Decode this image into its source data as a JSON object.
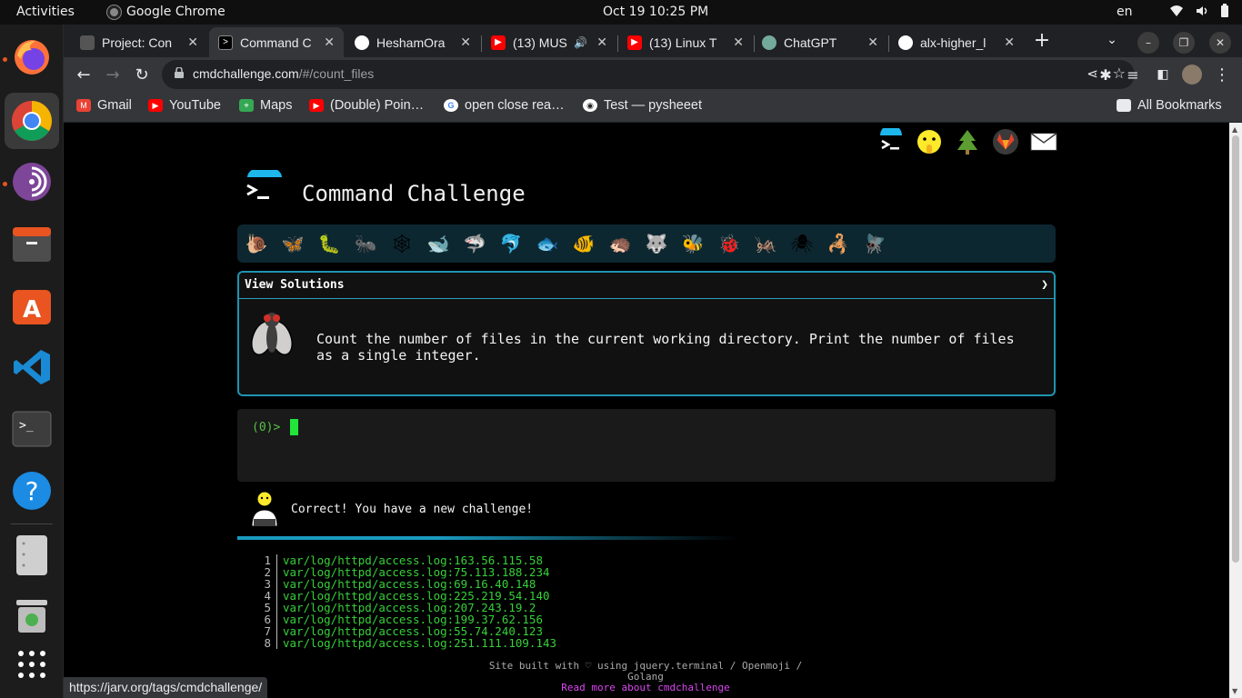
{
  "topbar": {
    "activities": "Activities",
    "app_name": "Google Chrome",
    "clock": "Oct 19  10:25 PM",
    "lang": "en"
  },
  "tabs": [
    {
      "title": "Project: Con",
      "icon": "project-icon"
    },
    {
      "title": "Command C",
      "icon": "terminal-icon"
    },
    {
      "title": "HeshamOra",
      "icon": "github-icon"
    },
    {
      "title": "(13) MUS",
      "icon": "youtube-icon"
    },
    {
      "title": "(13) Linux T",
      "icon": "youtube-icon"
    },
    {
      "title": "ChatGPT",
      "icon": "chatgpt-icon"
    },
    {
      "title": "alx-higher_l",
      "icon": "github-icon"
    }
  ],
  "omnibox": {
    "domain": "cmdchallenge.com",
    "path": "/#/count_files"
  },
  "bookmarks": [
    {
      "label": "Gmail",
      "color": "#ea4335"
    },
    {
      "label": "YouTube",
      "color": "#ff0000"
    },
    {
      "label": "Maps",
      "color": "#34a853"
    },
    {
      "label": "(Double) Poin…",
      "color": "#ff0000"
    },
    {
      "label": "open close rea…",
      "color": "#4285f4"
    },
    {
      "label": "Test — pysheeet",
      "color": "#ffffff"
    }
  ],
  "all_bookmarks": "All Bookmarks",
  "page": {
    "title": "Command Challenge",
    "view_solutions": "View Solutions",
    "chevron": "❯",
    "challenge_text": "Count the number of files in the current working directory. Print the number of files as a single integer.",
    "prompt": "(0)>",
    "result_message": "Correct! You have a new challenge!",
    "footer_line1": "Site built with ♡ using jquery.terminal / Openmoji / Golang",
    "footer_line2": "Read more about cmdchallenge"
  },
  "output_lines": [
    {
      "n": "1",
      "text": "var/log/httpd/access.log:163.56.115.58"
    },
    {
      "n": "2",
      "text": "var/log/httpd/access.log:75.113.188.234"
    },
    {
      "n": "3",
      "text": "var/log/httpd/access.log:69.16.40.148"
    },
    {
      "n": "4",
      "text": "var/log/httpd/access.log:225.219.54.140"
    },
    {
      "n": "5",
      "text": "var/log/httpd/access.log:207.243.19.2"
    },
    {
      "n": "6",
      "text": "var/log/httpd/access.log:199.37.62.156"
    },
    {
      "n": "7",
      "text": "var/log/httpd/access.log:55.74.240.123"
    },
    {
      "n": "8",
      "text": "var/log/httpd/access.log:251.111.109.143"
    }
  ],
  "badges": [
    "🐌",
    "🦋",
    "🐛",
    "🐜",
    "🕸",
    "🐋",
    "🦈",
    "🐬",
    "🐟",
    "🐠",
    "🦔",
    "🐺",
    "🐝",
    "🐞",
    "🦗",
    "🕷",
    "🦂",
    "🪰"
  ],
  "status_url": "https://jarv.org/tags/cmdchallenge/"
}
